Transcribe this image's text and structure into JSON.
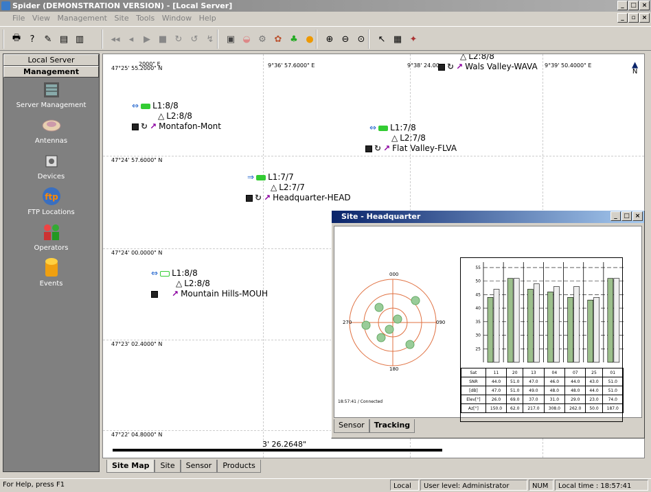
{
  "window": {
    "title": "Spider  (DEMONSTRATION VERSION) - [Local Server]"
  },
  "menu": [
    "File",
    "View",
    "Management",
    "Site",
    "Tools",
    "Window",
    "Help"
  ],
  "sidebar": {
    "header_top": "Local Server",
    "header_section": "Management",
    "items": [
      {
        "label": "Server Management",
        "icon": "server-icon"
      },
      {
        "label": "Antennas",
        "icon": "antenna-icon"
      },
      {
        "label": "Devices",
        "icon": "device-icon"
      },
      {
        "label": "FTP Locations",
        "icon": "ftp-icon"
      },
      {
        "label": "Operators",
        "icon": "operators-icon"
      },
      {
        "label": "Events",
        "icon": "events-icon"
      }
    ]
  },
  "map": {
    "lat_labels": [
      "47°25' 55.2000\" N",
      "47°24' 57.6000\" N",
      "47°24' 00.0000\" N",
      "47°23' 02.4000\" N",
      "47°22' 04.8000\" N"
    ],
    "lon_labels": [
      "9°36' 57.6000\" E",
      "9°38' 24.00",
      "9°39' 50.4000\" E"
    ],
    "top_partial": "2000\" E",
    "scale": "3' 26.2648\"",
    "north": "N",
    "sites": [
      {
        "l1": "L1:8/8",
        "l2": "L2:8/8",
        "name": "Montafon-Mont"
      },
      {
        "l1": "L1:7/8",
        "l2": "L2:7/8",
        "name": "Flat Valley-FLVA"
      },
      {
        "l1": "L1:7/7",
        "l2": "L2:7/7",
        "name": "Headquarter-HEAD"
      },
      {
        "l1": "L1:8/8",
        "l2": "L2:8/8",
        "name": "Mountain Hills-MOUH"
      },
      {
        "l1": "",
        "l2": "L2:8/8",
        "name": "Wals Valley-WAVA"
      }
    ]
  },
  "tabs": [
    "Site Map",
    "Site",
    "Sensor",
    "Products"
  ],
  "dialog": {
    "title": "Site - Headquarter",
    "sky_labels": {
      "n": "000",
      "e": "090",
      "s": "180",
      "w": "270"
    },
    "status": "18:57:41 / Connected",
    "tabs": [
      "Sensor",
      "Tracking"
    ],
    "tracking": {
      "yticks": [
        "55",
        "50",
        "45",
        "40",
        "35",
        "30",
        "25"
      ],
      "row_labels": [
        "Sat",
        "SNR",
        "[dB]",
        "Elev[°]",
        "Az[°]"
      ],
      "sats": [
        "11",
        "20",
        "13",
        "04",
        "07",
        "25",
        "01"
      ],
      "snr": [
        "44.0",
        "51.0",
        "47.0",
        "46.0",
        "44.0",
        "43.0",
        "51.0"
      ],
      "db": [
        "47.0",
        "51.0",
        "49.0",
        "48.0",
        "48.0",
        "44.0",
        "51.0"
      ],
      "elev": [
        "26.0",
        "69.0",
        "37.0",
        "31.0",
        "29.0",
        "23.0",
        "74.0"
      ],
      "az": [
        "150.0",
        "62.0",
        "217.0",
        "308.0",
        "262.0",
        "50.0",
        "187.0"
      ]
    }
  },
  "status": {
    "help": "For Help, press F1",
    "mode": "Local",
    "user": "User level: Administrator",
    "num": "NUM",
    "time": "Local time : 18:57:41"
  },
  "colors": {
    "sidebar": "#808080",
    "link_green": "#22aa22",
    "accent_blue": "#0a246a",
    "route": "#8b00a0"
  }
}
